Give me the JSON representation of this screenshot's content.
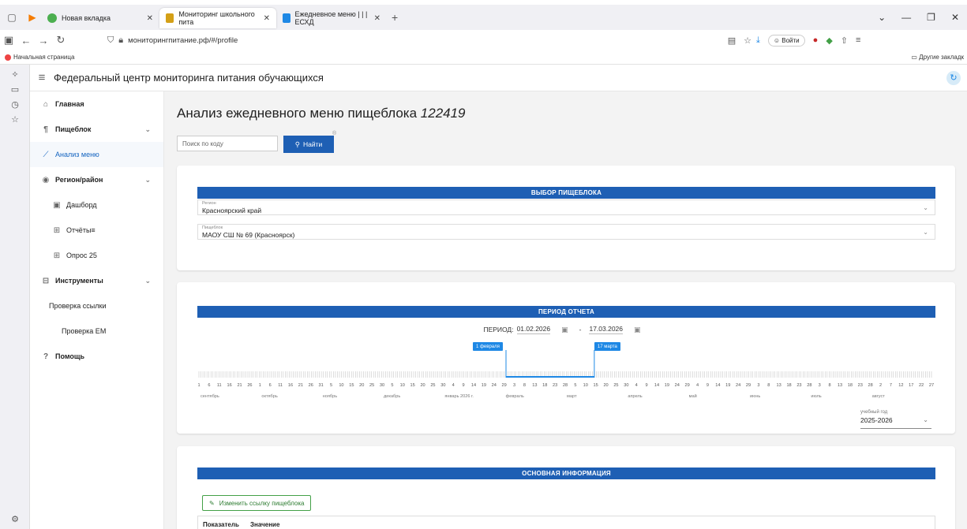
{
  "browser": {
    "tabs": [
      {
        "label": "Новая вкладка",
        "active": false
      },
      {
        "label": "Мониторинг школьного пита",
        "active": true
      },
      {
        "label": "Ежедневное меню | | | ЕСХД",
        "active": false
      }
    ],
    "url": "мониторингпитание.рф/#/profile",
    "login_label": "Войти",
    "bookmark_home": "Начальная страница",
    "bookmark_other": "Другие закладк"
  },
  "app": {
    "title": "Федеральный центр мониторинга питания обучающихся"
  },
  "sidebar": {
    "items": [
      {
        "label": "Главная"
      },
      {
        "label": "Пищеблок"
      },
      {
        "label": "Анализ меню"
      },
      {
        "label": "Регион/район"
      },
      {
        "label": "Дашборд"
      },
      {
        "label": "Отчёты≡"
      },
      {
        "label": "Опрос 25"
      },
      {
        "label": "Инструменты"
      },
      {
        "label": "Проверка ссылки"
      },
      {
        "label": "Проверка ЕМ"
      },
      {
        "label": "Помощь"
      }
    ]
  },
  "main": {
    "title_prefix": "Анализ ежедневного меню пищеблока",
    "title_code": "122419",
    "search_placeholder": "Поиск по коду",
    "search_button": "Найти",
    "search_badge": "®",
    "select_section": {
      "header": "ВЫБОР ПИЩЕБЛОКА",
      "region_label": "Регион",
      "region_value": "Красноярский край",
      "canteen_label": "Пищеблок",
      "canteen_value": "МАОУ СШ № 69 (Красноярск)"
    },
    "period_section": {
      "header": "ПЕРИОД ОТЧЕТА",
      "period_label": "ПЕРИОД:",
      "date_from": "01.02.2026",
      "date_sep": "-",
      "date_to": "17.03.2026",
      "tag_start": "1 февраля",
      "tag_end": "17 марта",
      "day_ticks": [
        "1",
        "6",
        "11",
        "16",
        "21",
        "26",
        "1",
        "6",
        "11",
        "16",
        "21",
        "26",
        "31",
        "5",
        "10",
        "15",
        "20",
        "25",
        "30",
        "5",
        "10",
        "15",
        "20",
        "25",
        "30",
        "4",
        "9",
        "14",
        "19",
        "24",
        "29",
        "3",
        "8",
        "13",
        "18",
        "23",
        "28",
        "5",
        "10",
        "15",
        "20",
        "25",
        "30",
        "4",
        "9",
        "14",
        "19",
        "24",
        "29",
        "4",
        "9",
        "14",
        "19",
        "24",
        "29",
        "3",
        "8",
        "13",
        "18",
        "23",
        "28",
        "3",
        "8",
        "13",
        "18",
        "23",
        "28",
        "2",
        "7",
        "12",
        "17",
        "22",
        "27"
      ],
      "months": [
        "сентябрь",
        "октябрь",
        "ноябрь",
        "декабрь",
        "январь 2026 г.",
        "февраль",
        "март",
        "апрель",
        "май",
        "июнь",
        "июль",
        "август"
      ],
      "year_label": "учебный год",
      "year_value": "2025-2026"
    },
    "info_section": {
      "header": "ОСНОВНАЯ ИНФОРМАЦИЯ",
      "edit_button": "Изменить ссылку пищеблока",
      "col_indicator": "Показатель",
      "col_value": "Значение"
    }
  },
  "colors": {
    "primary": "#1e5fb4",
    "tag": "#1e88e5",
    "success": "#43a047"
  }
}
